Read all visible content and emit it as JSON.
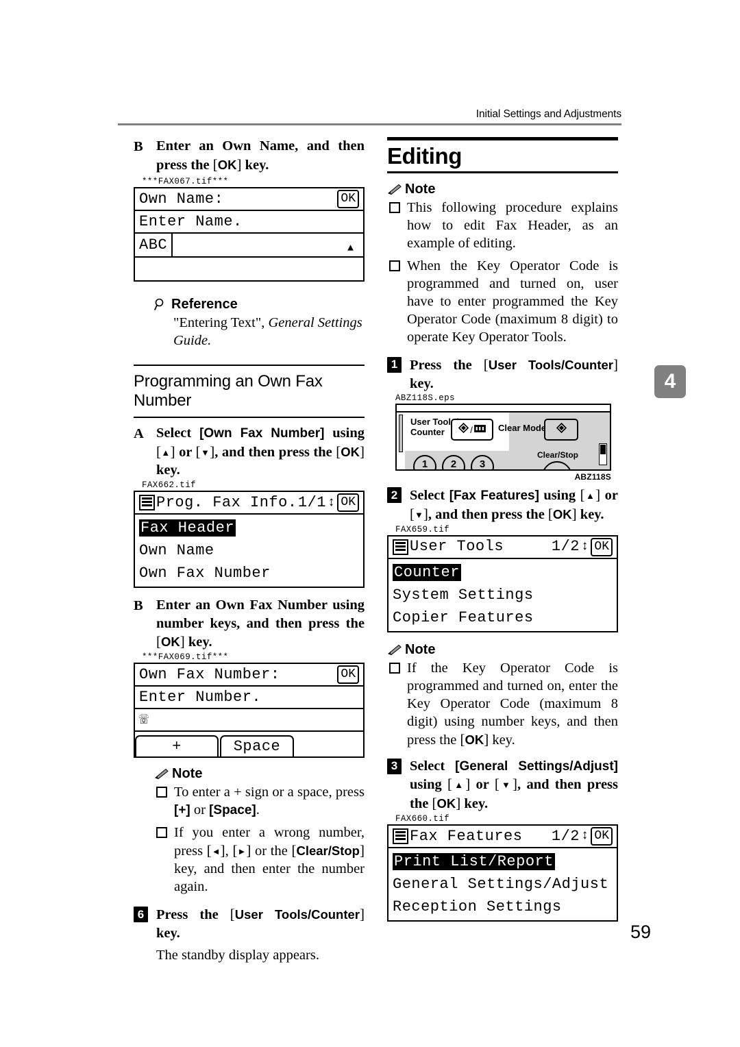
{
  "header": {
    "running_head": "Initial Settings and Adjustments"
  },
  "chapter_tab": {
    "number": "4"
  },
  "footer": {
    "page_number": "59"
  },
  "left_column": {
    "step_b_own_name": {
      "marker": "B",
      "text_1": "Enter an Own Name, and then press the ",
      "key": "OK",
      "text_2": " key."
    },
    "fax067": {
      "tif": "***FAX067.tif***",
      "title": "Own Name:",
      "ok": "OK",
      "prompt": "Enter Name.",
      "mode": "ABC"
    },
    "reference": {
      "heading": "Reference",
      "quoted": "\"Entering Text\", ",
      "italic": "General Settings Guide."
    },
    "h2_programming": "Programming an Own Fax Number",
    "step_a_own_fax": {
      "marker": "A",
      "text_1": "Select ",
      "bracket": "[Own Fax Number]",
      "text_2": " using ",
      "key_up": "▲",
      "text_3": " or ",
      "key_down": "▼",
      "text_4": ", and then press the ",
      "key_ok": "OK",
      "text_5": " key."
    },
    "fax662": {
      "tif": "FAX662.tif",
      "title": "Prog. Fax Info.",
      "page": "1/1",
      "ok": "OK",
      "items": [
        "Fax Header",
        "Own Name",
        "Own Fax Number"
      ],
      "selected_index": 0
    },
    "step_b_own_fax": {
      "marker": "B",
      "text_1": "Enter an Own Fax Number using number keys, and then press the ",
      "key": "OK",
      "text_2": " key."
    },
    "fax069": {
      "tif": "***FAX069.tif***",
      "title": "Own Fax Number:",
      "ok": "OK",
      "prompt": "Enter Number.",
      "key_plus": "+",
      "key_space": "Space"
    },
    "note": {
      "heading": "Note",
      "items": [
        {
          "text_1": "To enter a + sign or a space, press ",
          "b1": "[+]",
          "text_2": " or ",
          "b2": "[Space]",
          "text_3": "."
        },
        {
          "text_1": "If you enter a wrong number, press ",
          "k1": "◄",
          "text_2": ", ",
          "k2": "►",
          "text_3": " or the ",
          "k3": "Clear/Stop",
          "text_4": " key, and then enter the number again."
        }
      ]
    },
    "step_6": {
      "marker": "6",
      "text_1": "Press the ",
      "key": "User Tools/Counter",
      "text_2": " key.",
      "body": "The standby display appears."
    }
  },
  "right_column": {
    "h1_editing": "Editing",
    "note_top": {
      "heading": "Note",
      "items": [
        "This following procedure explains how to edit Fax Header, as an example of editing.",
        "When the Key Operator Code is programmed and turned on, user have to enter programmed the Key Operator Code (maximum 8 digit) to operate Key Operator Tools."
      ]
    },
    "step_1": {
      "marker": "1",
      "text_1": "Press the ",
      "key": "User Tools/Counter",
      "text_2": " key."
    },
    "panel_fig": {
      "tif": "ABZ118S.eps",
      "label_user_tools": "User Tools/\nCounter",
      "label_clear_modes": "Clear Modes",
      "label_clear_stop": "Clear/Stop",
      "numbers": [
        "1",
        "2",
        "3"
      ],
      "code": "ABZ118S"
    },
    "step_2": {
      "marker": "2",
      "text_1": "Select ",
      "bracket": "[Fax Features]",
      "text_2": " using ",
      "key_up": "▲",
      "text_3": " or ",
      "key_down": "▼",
      "text_4": ", and then press the ",
      "key_ok": "OK",
      "text_5": " key."
    },
    "fax659": {
      "tif": "FAX659.tif",
      "title": "User Tools",
      "page": "1/2",
      "ok": "OK",
      "items": [
        "Counter",
        "System Settings",
        "Copier Features"
      ],
      "selected_index": 0
    },
    "note_mid": {
      "heading": "Note",
      "item": {
        "text_1": "If the Key Operator Code is programmed and turned on, enter the Key Operator Code (maximum 8 digit) using number keys, and then press the ",
        "key": "OK",
        "text_2": " key."
      }
    },
    "step_3": {
      "marker": "3",
      "text_1": "Select ",
      "bracket": "[General Settings/Adjust]",
      "text_2": " using ",
      "key_up": "▲",
      "text_3": " or ",
      "key_down": "▼",
      "text_4": ", and then press the ",
      "key_ok": "OK",
      "text_5": " key."
    },
    "fax660": {
      "tif": "FAX660.tif",
      "title": "Fax Features",
      "page": "1/2",
      "ok": "OK",
      "items": [
        "Print List/Report",
        "General Settings/Adjust",
        "Reception Settings"
      ],
      "selected_index": 0
    }
  }
}
